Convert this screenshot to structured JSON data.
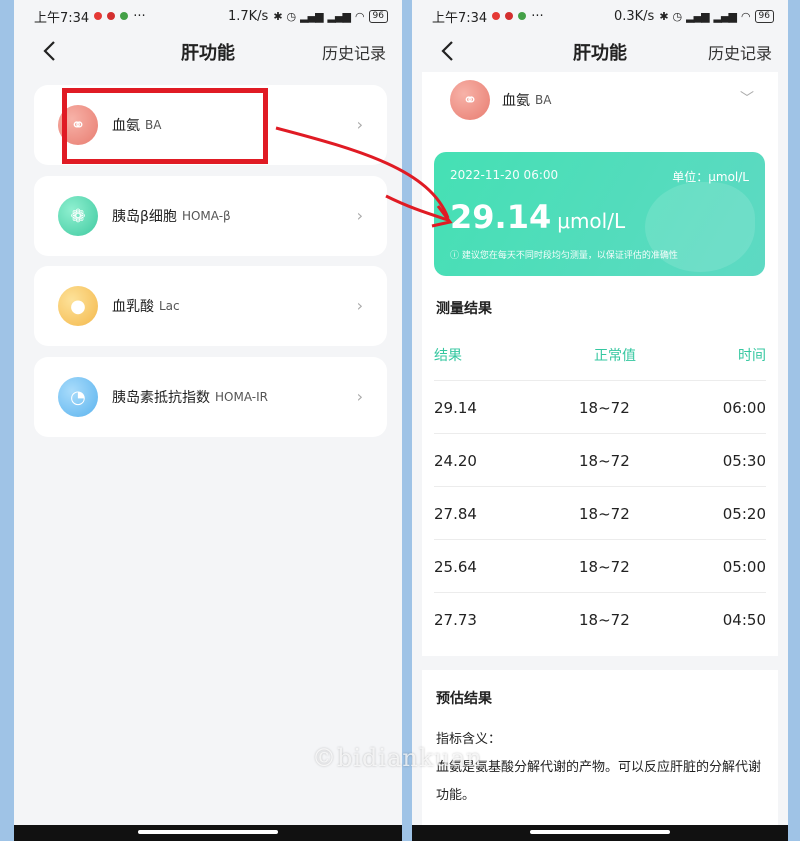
{
  "left": {
    "status": {
      "time": "上午7:34",
      "speed": "1.7K/s",
      "battery": "96"
    },
    "nav": {
      "title": "肝功能",
      "history": "历史记录"
    },
    "items": [
      {
        "name": "血氨",
        "abbr": "BA"
      },
      {
        "name": "胰岛β细胞",
        "abbr": "HOMA-β"
      },
      {
        "name": "血乳酸",
        "abbr": "Lac"
      },
      {
        "name": "胰岛素抵抗指数",
        "abbr": "HOMA-IR"
      }
    ]
  },
  "right": {
    "status": {
      "time": "上午7:34",
      "speed": "0.3K/s",
      "battery": "96"
    },
    "nav": {
      "title": "肝功能",
      "history": "历史记录"
    },
    "selector": {
      "name": "血氨",
      "abbr": "BA"
    },
    "banner": {
      "date": "2022-11-20 06:00",
      "unit_label": "单位：μmol/L",
      "value": "29.14",
      "value_unit": "μmol/L",
      "tip": "建议您在每天不同时段均匀测量，以保证评估的准确性"
    },
    "result_title": "测量结果",
    "table": {
      "headers": [
        "结果",
        "正常值",
        "时间"
      ],
      "rows": [
        [
          "29.14",
          "18~72",
          "06:00"
        ],
        [
          "24.20",
          "18~72",
          "05:30"
        ],
        [
          "27.84",
          "18~72",
          "05:20"
        ],
        [
          "25.64",
          "18~72",
          "05:00"
        ],
        [
          "27.73",
          "18~72",
          "04:50"
        ]
      ]
    },
    "estimate_title": "预估结果",
    "meaning_label": "指标含义：",
    "meaning_text": "血氨是氨基酸分解代谢的产物。可以反应肝脏的分解代谢功能。"
  },
  "watermark": "©bidiankuan",
  "colors": {
    "accent": "#45e0b4",
    "highlight": "#e01b24",
    "background": "#9fc3e6"
  }
}
